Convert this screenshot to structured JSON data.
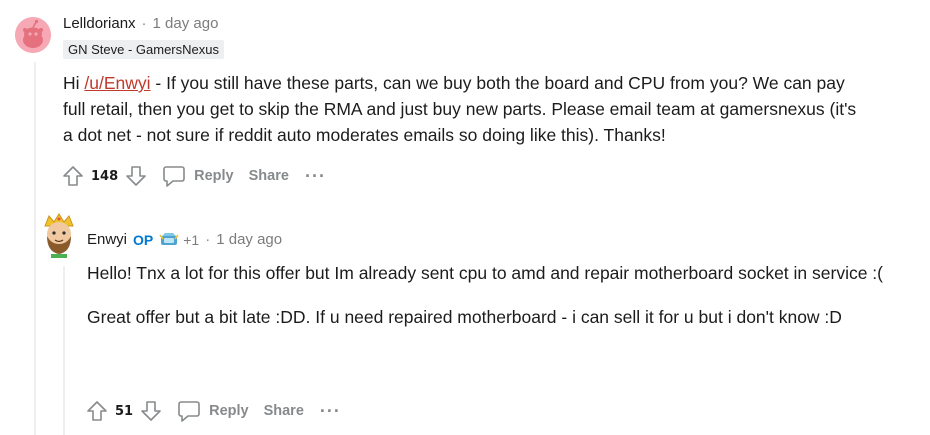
{
  "comment1": {
    "username": "Lelldorianx",
    "separator": "·",
    "timestamp": "1 day ago",
    "flair": "GN Steve - GamersNexus",
    "text_prefix": "Hi ",
    "mention": "/u/Enwyi",
    "text_suffix": " - If you still have these parts, can we buy both the board and CPU from you? We can pay full retail, then you get to skip the RMA and just buy new parts. Please email team at gamersnexus (it's a dot net - not sure if reddit auto moderates emails so doing like this). Thanks!",
    "score": "148",
    "reply_label": "Reply",
    "share_label": "Share",
    "more_label": "···"
  },
  "comment2": {
    "username": "Enwyi",
    "op_badge": "OP",
    "award_count": "+1",
    "separator": "·",
    "timestamp": "1 day ago",
    "paragraphs": [
      "Hello! Tnx a lot for this offer but Im already sent cpu to amd and repair motherboard socket in service :(",
      "Great offer but a bit late :DD. If u need repaired motherboard - i can sell it for u but i don't know :D"
    ],
    "score": "51",
    "reply_label": "Reply",
    "share_label": "Share",
    "more_label": "···"
  },
  "colors": {
    "mention": "#c0392b",
    "op": "#0079d3",
    "muted": "#878a8c",
    "thread_line": "#edeff1"
  },
  "icons": [
    "snoo-avatar",
    "user-avatar",
    "upvote-icon",
    "downvote-icon",
    "comment-icon",
    "award-icon"
  ]
}
